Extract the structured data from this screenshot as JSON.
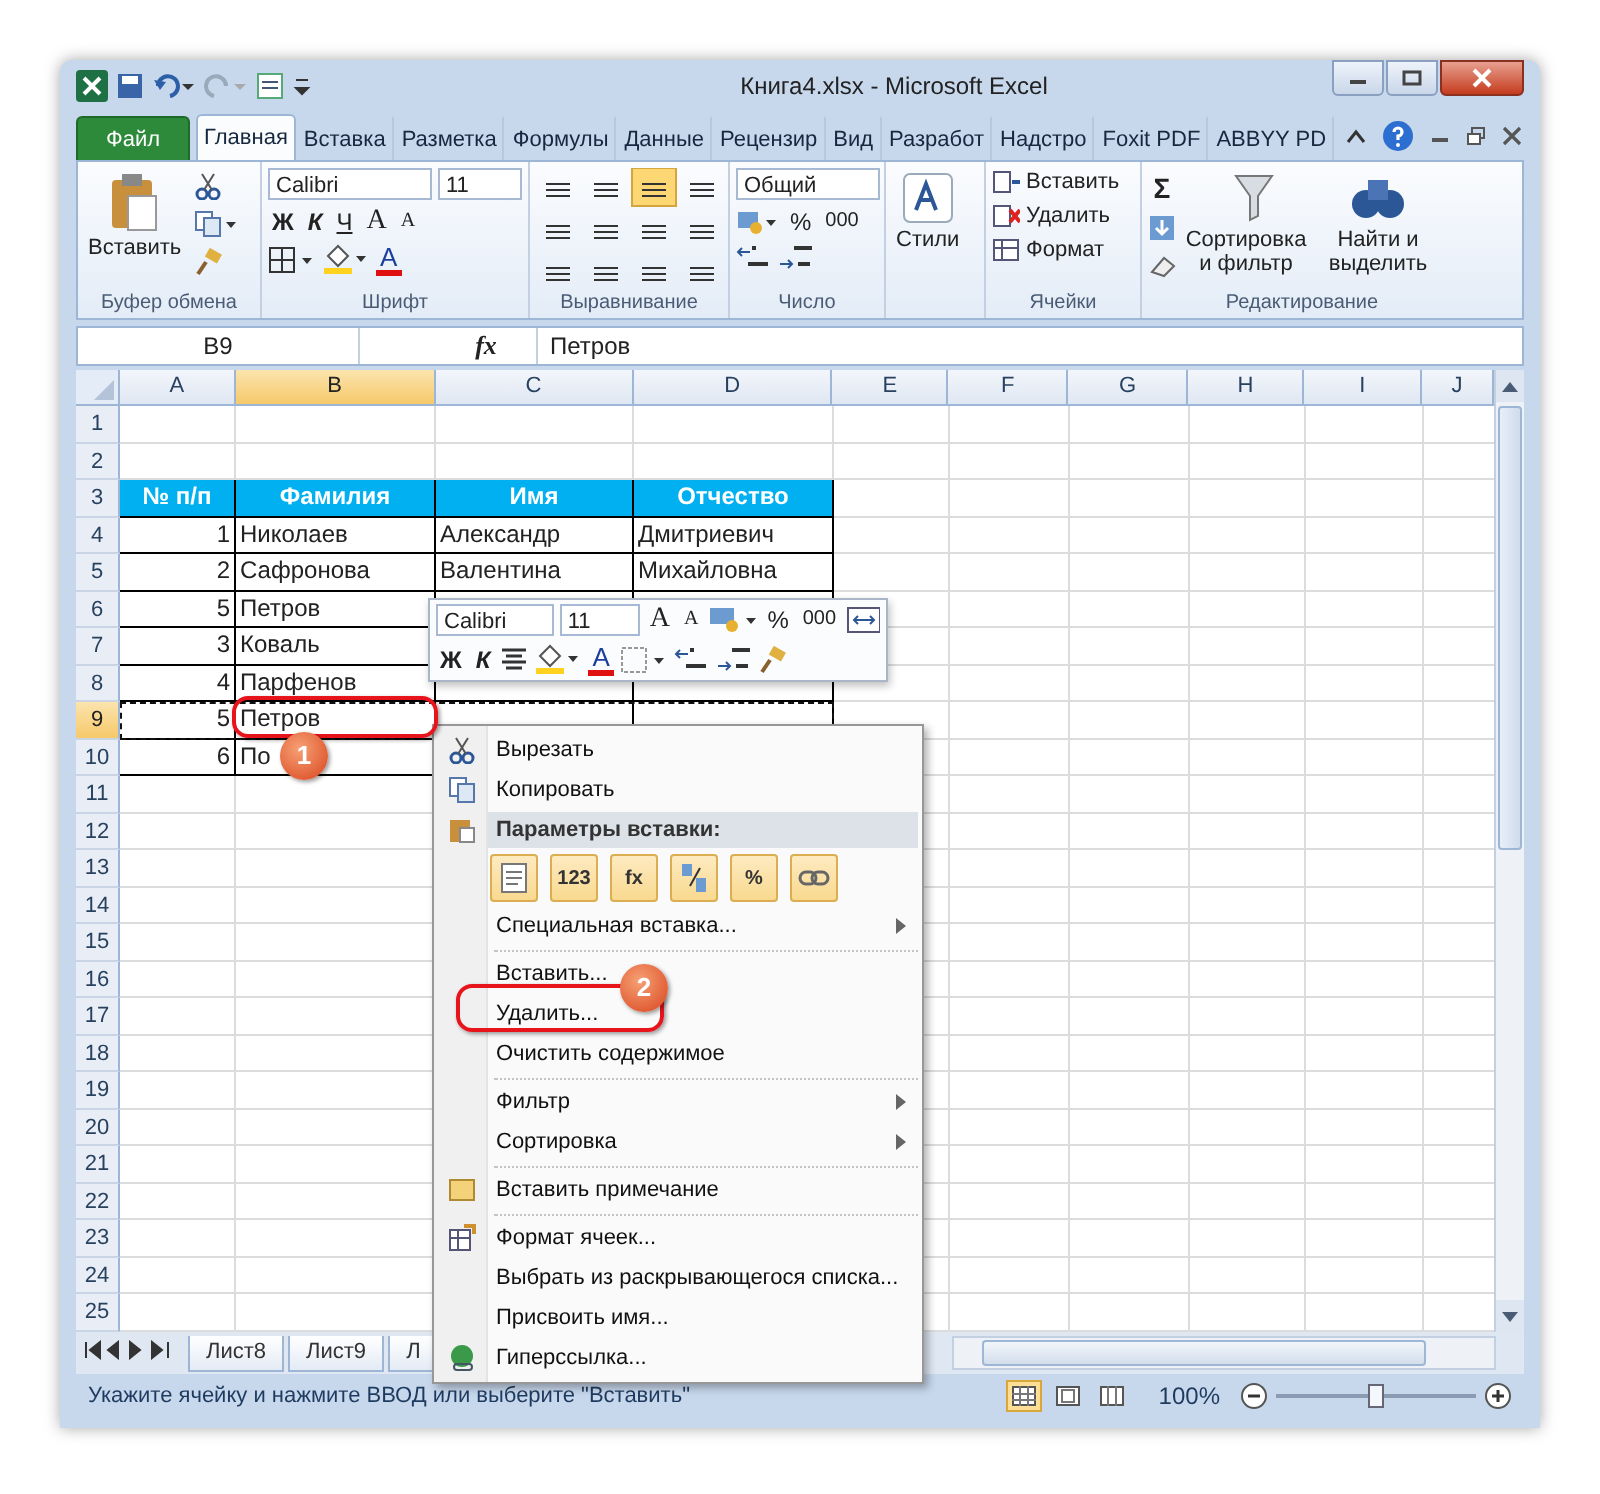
{
  "window": {
    "title": "Книга4.xlsx  -  Microsoft Excel"
  },
  "ribbon_tabs": [
    {
      "label": "Файл",
      "kind": "file",
      "selected": false
    },
    {
      "label": "Главная",
      "kind": "tab",
      "selected": true
    },
    {
      "label": "Вставка",
      "kind": "tab",
      "selected": false
    },
    {
      "label": "Разметка",
      "kind": "tab",
      "selected": false
    },
    {
      "label": "Формулы",
      "kind": "tab",
      "selected": false
    },
    {
      "label": "Данные",
      "kind": "tab",
      "selected": false
    },
    {
      "label": "Рецензир",
      "kind": "tab",
      "selected": false
    },
    {
      "label": "Вид",
      "kind": "tab",
      "selected": false
    },
    {
      "label": "Разработ",
      "kind": "tab",
      "selected": false
    },
    {
      "label": "Надстро",
      "kind": "tab",
      "selected": false
    },
    {
      "label": "Foxit PDF",
      "kind": "tab",
      "selected": false
    },
    {
      "label": "ABBYY PD",
      "kind": "tab",
      "selected": false
    }
  ],
  "ribbon": {
    "clipboard": {
      "paste": "Вставить",
      "label": "Буфер обмена"
    },
    "font": {
      "name": "Calibri",
      "size": "11",
      "bold": "Ж",
      "italic": "К",
      "underline": "Ч",
      "grow": "A",
      "shrink": "A",
      "font_color_letter": "A",
      "label": "Шрифт"
    },
    "alignment": {
      "label": "Выравнивание"
    },
    "number": {
      "format": "Общий",
      "percent": "%",
      "thousands": "000",
      "label": "Число"
    },
    "styles": {
      "button": "Стили"
    },
    "cells": {
      "insert": "Вставить",
      "delete": "Удалить",
      "format": "Формат",
      "label": "Ячейки"
    },
    "editing": {
      "sum": "Σ",
      "sort": "Сортировка и фильтр",
      "find": "Найти и выделить",
      "label": "Редактирование"
    }
  },
  "formula_bar": {
    "name_box": "B9",
    "fx": "fx",
    "value": "Петров"
  },
  "columns": [
    {
      "label": "A",
      "selected": false
    },
    {
      "label": "B",
      "selected": true
    },
    {
      "label": "C",
      "selected": false
    },
    {
      "label": "D",
      "selected": false
    },
    {
      "label": "E",
      "selected": false
    },
    {
      "label": "F",
      "selected": false
    },
    {
      "label": "G",
      "selected": false
    },
    {
      "label": "H",
      "selected": false
    },
    {
      "label": "I",
      "selected": false
    },
    {
      "label": "J",
      "selected": false
    }
  ],
  "rows": [
    {
      "number": "1",
      "selected": false,
      "kind": "plain",
      "copied": false,
      "cells": {}
    },
    {
      "number": "2",
      "selected": false,
      "kind": "plain",
      "copied": false,
      "cells": {}
    },
    {
      "number": "3",
      "selected": false,
      "kind": "table-header",
      "copied": false,
      "cells": {
        "A": "№ п/п",
        "B": "Фамилия",
        "C": "Имя",
        "D": "Отчество"
      }
    },
    {
      "number": "4",
      "selected": false,
      "kind": "table",
      "copied": false,
      "cells": {
        "A": "1",
        "B": "Николаев",
        "C": "Александр",
        "D": "Дмитриевич"
      }
    },
    {
      "number": "5",
      "selected": false,
      "kind": "table",
      "copied": false,
      "cells": {
        "A": "2",
        "B": "Сафронова",
        "C": "Валентина",
        "D": "Михайловна"
      }
    },
    {
      "number": "6",
      "selected": false,
      "kind": "table",
      "copied": false,
      "cells": {
        "A": "5",
        "B": "Петров"
      }
    },
    {
      "number": "7",
      "selected": false,
      "kind": "table",
      "copied": false,
      "cells": {
        "A": "3",
        "B": "Коваль"
      }
    },
    {
      "number": "8",
      "selected": false,
      "kind": "table",
      "copied": false,
      "cells": {
        "A": "4",
        "B": "Парфенов"
      }
    },
    {
      "number": "9",
      "selected": true,
      "kind": "table",
      "copied": true,
      "cells": {
        "A": "5",
        "B": "Петров"
      }
    },
    {
      "number": "10",
      "selected": false,
      "kind": "table",
      "copied": false,
      "cells": {
        "A": "6",
        "B": "По"
      }
    },
    {
      "number": "11",
      "selected": false,
      "kind": "plain",
      "copied": false,
      "cells": {}
    },
    {
      "number": "12",
      "selected": false,
      "kind": "plain",
      "copied": false,
      "cells": {}
    },
    {
      "number": "13",
      "selected": false,
      "kind": "plain",
      "copied": false,
      "cells": {}
    },
    {
      "number": "14",
      "selected": false,
      "kind": "plain",
      "copied": false,
      "cells": {}
    },
    {
      "number": "15",
      "selected": false,
      "kind": "plain",
      "copied": false,
      "cells": {}
    },
    {
      "number": "16",
      "selected": false,
      "kind": "plain",
      "copied": false,
      "cells": {}
    },
    {
      "number": "17",
      "selected": false,
      "kind": "plain",
      "copied": false,
      "cells": {}
    },
    {
      "number": "18",
      "selected": false,
      "kind": "plain",
      "copied": false,
      "cells": {}
    },
    {
      "number": "19",
      "selected": false,
      "kind": "plain",
      "copied": false,
      "cells": {}
    },
    {
      "number": "20",
      "selected": false,
      "kind": "plain",
      "copied": false,
      "cells": {}
    },
    {
      "number": "21",
      "selected": false,
      "kind": "plain",
      "copied": false,
      "cells": {}
    },
    {
      "number": "22",
      "selected": false,
      "kind": "plain",
      "copied": false,
      "cells": {}
    },
    {
      "number": "23",
      "selected": false,
      "kind": "plain",
      "copied": false,
      "cells": {}
    },
    {
      "number": "24",
      "selected": false,
      "kind": "plain",
      "copied": false,
      "cells": {}
    },
    {
      "number": "25",
      "selected": false,
      "kind": "plain",
      "copied": false,
      "cells": {}
    }
  ],
  "sheet_tabs": [
    {
      "label": "Лист8",
      "selected": false
    },
    {
      "label": "Лист9",
      "selected": false
    },
    {
      "label": "Л",
      "selected": false
    }
  ],
  "mini_toolbar": {
    "font": "Calibri",
    "size": "11",
    "grow": "A",
    "shrink": "A",
    "percent": "%",
    "thousands": "000",
    "bold": "Ж",
    "italic": "К",
    "font_color_letter": "A"
  },
  "context_menu": [
    {
      "kind": "cut",
      "label": "Вырезать",
      "submenu": false
    },
    {
      "kind": "copy",
      "label": "Копировать",
      "submenu": false
    },
    {
      "kind": "header",
      "label": "Параметры вставки:"
    },
    {
      "kind": "paste-options",
      "options": [
        {
          "kind": "plain"
        },
        {
          "kind": "text",
          "label": "123"
        },
        {
          "kind": "text",
          "label": "fx"
        },
        {
          "kind": "transpose"
        },
        {
          "kind": "text",
          "label": "%"
        },
        {
          "kind": "link"
        }
      ]
    },
    {
      "kind": "item",
      "label": "Специальная вставка...",
      "submenu": true
    },
    {
      "kind": "separator"
    },
    {
      "kind": "item",
      "label": "Вставить...",
      "submenu": false
    },
    {
      "kind": "item",
      "label": "Удалить...",
      "submenu": false
    },
    {
      "kind": "item",
      "label": "Очистить содержимое",
      "submenu": false
    },
    {
      "kind": "separator"
    },
    {
      "kind": "item",
      "label": "Фильтр",
      "submenu": true
    },
    {
      "kind": "item",
      "label": "Сортировка",
      "submenu": true
    },
    {
      "kind": "separator"
    },
    {
      "kind": "comment",
      "label": "Вставить примечание",
      "submenu": false
    },
    {
      "kind": "separator"
    },
    {
      "kind": "format-cells",
      "label": "Формат ячеек...",
      "submenu": false
    },
    {
      "kind": "item",
      "label": "Выбрать из раскрывающегося списка...",
      "submenu": false
    },
    {
      "kind": "item",
      "label": "Присвоить имя...",
      "submenu": false
    },
    {
      "kind": "hyperlink",
      "label": "Гиперссылка...",
      "submenu": false
    }
  ],
  "callouts": [
    {
      "number": "1"
    },
    {
      "number": "2"
    }
  ],
  "status_bar": {
    "message": "Укажите ячейку и нажмите ВВОД или выберите \"Вставить\"",
    "views": [
      {
        "kind": "normal",
        "selected": true
      },
      {
        "kind": "layout",
        "selected": false
      },
      {
        "kind": "pagebreak",
        "selected": false
      }
    ],
    "zoom": "100%",
    "level": 0.5
  }
}
